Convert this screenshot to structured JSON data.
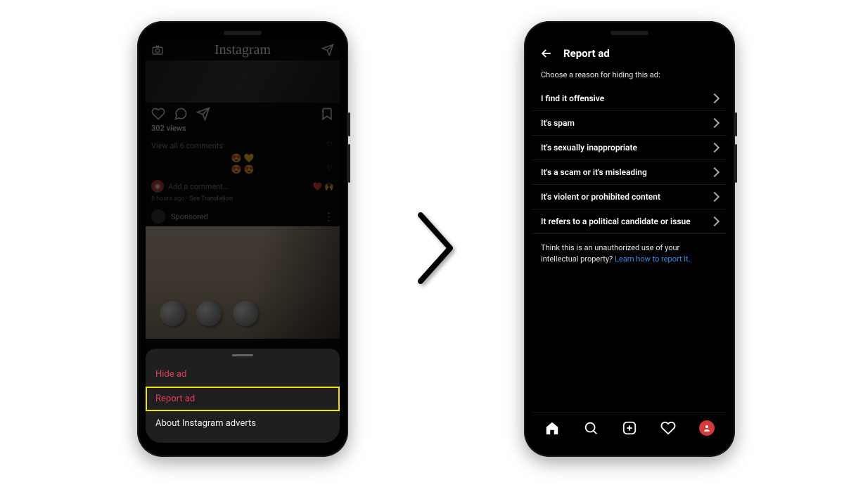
{
  "left": {
    "app_logo_text": "Instagram",
    "views_label": "302 views",
    "view_comments": "View all 6 comments",
    "emoji_line1": "😍 💛",
    "emoji_line2": "😍 😍",
    "add_comment_placeholder": "Add a comment...",
    "comment_emoji": "❤️  🙌",
    "time_text": "8 hours ago · ",
    "see_translation": "See Translation",
    "sponsored_label": "Sponsored",
    "sheet": {
      "hide": "Hide ad",
      "report": "Report ad",
      "about": "About Instagram adverts"
    }
  },
  "right": {
    "title": "Report ad",
    "subtitle": "Choose a reason for hiding this ad:",
    "reasons": [
      "I find it offensive",
      "It's spam",
      "It's sexually inappropriate",
      "It's a scam or it's misleading",
      "It's violent or prohibited content",
      "It refers to a political candidate or issue"
    ],
    "ip_text": "Think this is an unauthorized use of your intellectual property? ",
    "ip_link": "Learn how to report it."
  }
}
